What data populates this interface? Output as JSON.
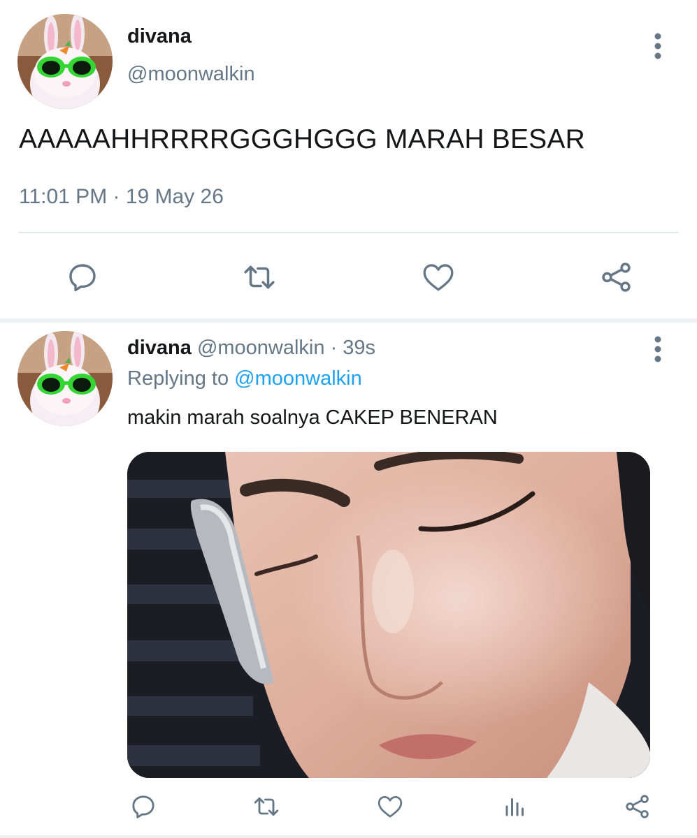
{
  "main_tweet": {
    "display_name": "divana",
    "handle": "@moonwalkin",
    "text": "AAAAAHHRRRRGGGHGGG MARAH BESAR",
    "timestamp": "11:01 PM · 19 May 26",
    "actions": [
      "reply-icon",
      "retweet-icon",
      "like-icon",
      "share-icon"
    ]
  },
  "reply_tweet": {
    "display_name": "divana",
    "handle": "@moonwalkin",
    "separator": " · ",
    "age": "39s",
    "replying_prefix": "Replying to ",
    "replying_to": "@moonwalkin",
    "text": "makin marah soalnya CAKEP BENERAN",
    "actions": [
      "reply-icon",
      "retweet-icon",
      "like-icon",
      "analytics-icon",
      "share-icon"
    ]
  },
  "colors": {
    "primary_text": "#14171a",
    "secondary_text": "#657786",
    "accent": "#1da1f2",
    "divider": "#e1e8ed"
  }
}
